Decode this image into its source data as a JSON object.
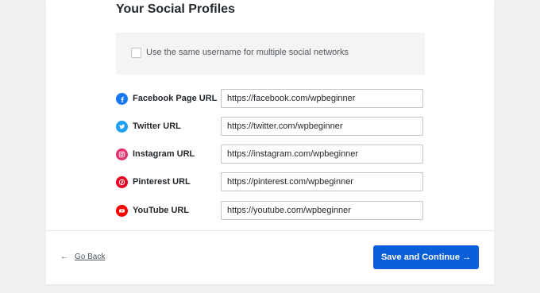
{
  "page": {
    "title": "Your Social Profiles"
  },
  "same_username": {
    "label": "Use the same username for multiple social networks",
    "checked": false
  },
  "profiles": [
    {
      "label": "Facebook Page URL",
      "value": "https://facebook.com/wpbeginner",
      "icon": "facebook-icon",
      "color": "#1877f2"
    },
    {
      "label": "Twitter URL",
      "value": "https://twitter.com/wpbeginner",
      "icon": "twitter-icon",
      "color": "#1da1f2"
    },
    {
      "label": "Instagram URL",
      "value": "https://instagram.com/wpbeginner",
      "icon": "instagram-icon",
      "color": "#e1306c"
    },
    {
      "label": "Pinterest URL",
      "value": "https://pinterest.com/wpbeginner",
      "icon": "pinterest-icon",
      "color": "#e60023"
    },
    {
      "label": "YouTube URL",
      "value": "https://youtube.com/wpbeginner",
      "icon": "youtube-icon",
      "color": "#ff0000"
    }
  ],
  "footer": {
    "back_arrow": "←",
    "back_label": "Go Back",
    "save_label": "Save and Continue →"
  },
  "colors": {
    "primary_button": "#0a5fd9",
    "background": "#f1f1f1",
    "card": "#ffffff"
  }
}
